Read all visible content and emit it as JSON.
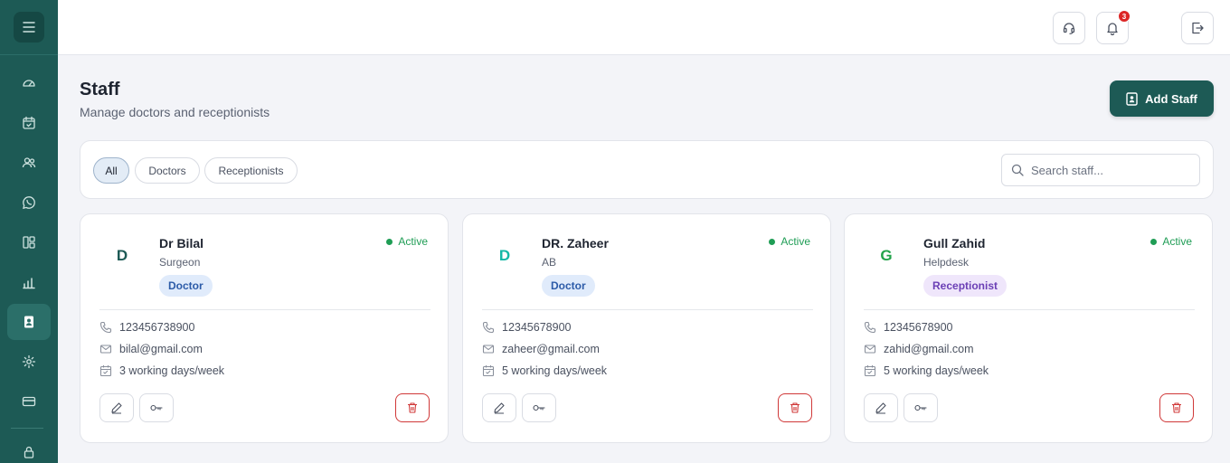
{
  "colors": {
    "sidebar": "#1d5a55",
    "accent": "#1d5a55",
    "active_status": "#1f9d55",
    "danger": "#d03838"
  },
  "sidebar": {
    "items": [
      {
        "icon": "dashboard-gauge-icon"
      },
      {
        "icon": "calendar-check-icon"
      },
      {
        "icon": "users-icon"
      },
      {
        "icon": "whatsapp-icon"
      },
      {
        "icon": "layout-grid-icon"
      },
      {
        "icon": "bar-chart-icon"
      },
      {
        "icon": "staff-badge-icon",
        "active": true
      },
      {
        "icon": "settings-gear-icon"
      },
      {
        "icon": "credit-card-icon"
      },
      {
        "icon": "lock-icon"
      }
    ]
  },
  "topbar": {
    "notification_count": "3"
  },
  "header": {
    "title": "Staff",
    "subtitle": "Manage doctors and receptionists",
    "add_button": "Add Staff"
  },
  "filters": {
    "tabs": [
      "All",
      "Doctors",
      "Receptionists"
    ],
    "active": "All",
    "search_placeholder": "Search staff..."
  },
  "staff": [
    {
      "initial": "D",
      "initial_color": "#1d5a55",
      "name": "Dr Bilal",
      "role": "Surgeon",
      "type": "Doctor",
      "status": "Active",
      "phone": "123456738900",
      "email": "bilal@gmail.com",
      "schedule": "3 working days/week"
    },
    {
      "initial": "D",
      "initial_color": "#14b8a6",
      "name": "DR. Zaheer",
      "role": "AB",
      "type": "Doctor",
      "status": "Active",
      "phone": "12345678900",
      "email": "zaheer@gmail.com",
      "schedule": "5 working days/week"
    },
    {
      "initial": "G",
      "initial_color": "#22a34a",
      "name": "Gull Zahid",
      "role": "Helpdesk",
      "type": "Receptionist",
      "status": "Active",
      "phone": "12345678900",
      "email": "zahid@gmail.com",
      "schedule": "5 working days/week"
    }
  ]
}
